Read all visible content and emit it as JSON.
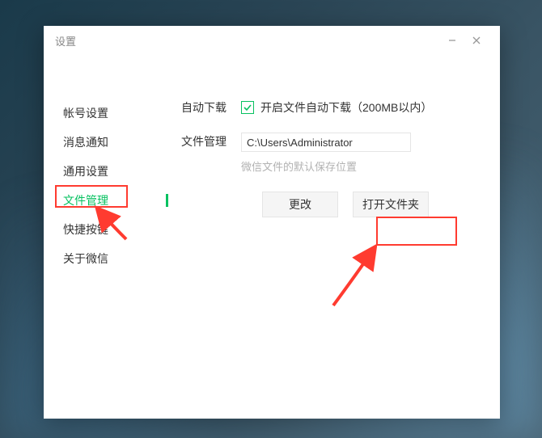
{
  "window": {
    "title": "设置"
  },
  "sidebar": {
    "items": [
      {
        "label": "帐号设置"
      },
      {
        "label": "消息通知"
      },
      {
        "label": "通用设置"
      },
      {
        "label": "文件管理",
        "active": true
      },
      {
        "label": "快捷按键"
      },
      {
        "label": "关于微信"
      }
    ]
  },
  "main": {
    "autoDownload": {
      "label": "自动下载",
      "checkboxText": "开启文件自动下载（200MB以内）",
      "checked": true
    },
    "fileManage": {
      "label": "文件管理",
      "path": "C:\\Users\\Administrator",
      "hint": "微信文件的默认保存位置",
      "changeButton": "更改",
      "openFolderButton": "打开文件夹"
    }
  },
  "annotations": {
    "highlightColor": "#ff3b30"
  }
}
